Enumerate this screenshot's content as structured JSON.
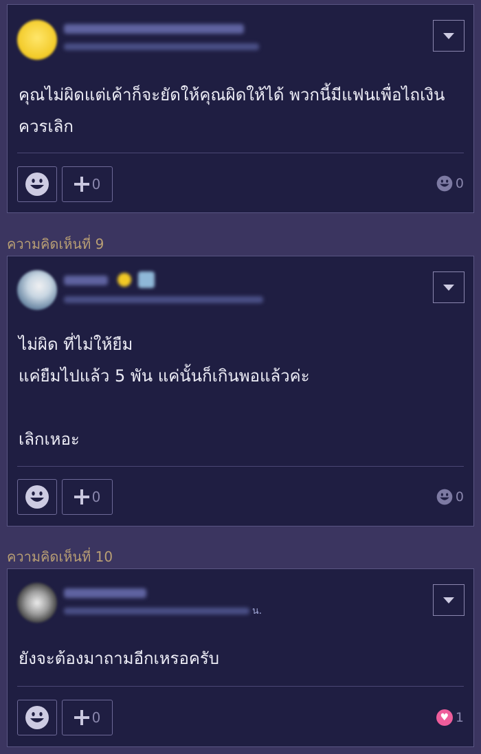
{
  "comments": [
    {
      "date_tail": "",
      "body": "คุณไม่ผิดแต่เค้าก็จะยัดให้คุณผิดให้ได้ พวกนี้มีแฟนเพื่อไถเงิน ควรเลิก",
      "plus_count": "0",
      "reaction_count": "0",
      "reaction_icon": "smile-icon"
    },
    {
      "label": "ความคิดเห็นที่ 9",
      "date_tail": "",
      "body": "ไม่ผิด ที่ไม่ให้ยืม\nแค่ยืมไปแล้ว 5 พัน แค่นั้นก็เกินพอแล้วค่ะ\n\nเลิกเหอะ",
      "plus_count": "0",
      "reaction_count": "0",
      "reaction_icon": "smile-icon"
    },
    {
      "label": "ความคิดเห็นที่ 10",
      "date_tail": "น.",
      "body": "ยังจะต้องมาถามอีกเหรอครับ",
      "plus_count": "0",
      "reaction_count": "1",
      "reaction_icon": "heart-icon"
    }
  ],
  "colors": {
    "background": "#3b3560",
    "card": "#1f1e42",
    "label": "#b89e74",
    "heart": "#ee5d9b"
  }
}
